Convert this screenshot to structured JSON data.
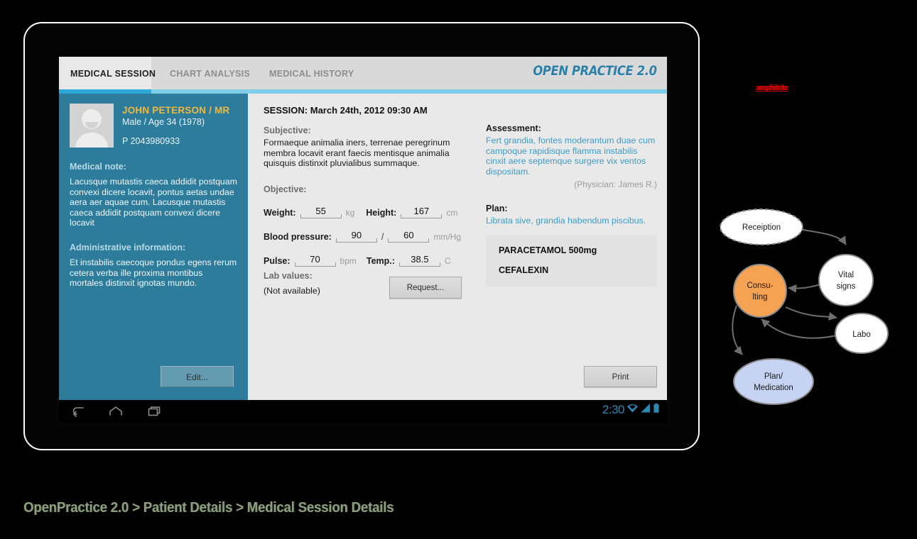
{
  "tabs": [
    {
      "label": "MEDICAL SESSION",
      "active": true
    },
    {
      "label": "CHART ANALYSIS",
      "active": false
    },
    {
      "label": "MEDICAL HISTORY",
      "active": false
    }
  ],
  "brand": {
    "logo": "OPEN PRACTICE 2.0"
  },
  "patient": {
    "name": "JOHN PETERSON / MR",
    "demographics": "Male / Age 34 (1978)",
    "id": "P 2043980933",
    "medical_note_heading": "Medical note:",
    "medical_note": "Lacusque mutastis caeca addidit postquam convexi dicere locavit, pontus aetas undae aera aer aquae cum. Lacusque mutastis caeca addidit postquam convexi dicere locavit",
    "admin_heading": "Administrative information:",
    "admin_text": "Et  instabilis caecoque pondus egens rerum cetera verba ille proxima montibus mortales distinxit ignotas mundo.",
    "edit_label": "Edit..."
  },
  "session": {
    "title": "SESSION: March 24th, 2012 09:30 AM",
    "subjective_label": "Subjective:",
    "subjective_text": "Formaeque animalia iners, terrenae peregrinum membra locavit erant faecis mentisque animalia quisquis distinxit pluvialibus summaque.",
    "objective_label": "Objective:",
    "vitals": {
      "weight_label": "Weight:",
      "weight_value": "55",
      "weight_unit": "kg",
      "height_label": "Height:",
      "height_value": "167",
      "height_unit": "cm",
      "bp_label": "Blood pressure:",
      "bp_systolic": "90",
      "bp_separator": "/",
      "bp_diastolic": "60",
      "bp_unit": "mm/Hg",
      "pulse_label": "Pulse:",
      "pulse_value": "70",
      "pulse_unit": "bpm",
      "temp_label": "Temp.:",
      "temp_value": "38.5",
      "temp_unit": "C"
    },
    "lab_label": "Lab values:",
    "lab_value": "(Not available)",
    "request_label": "Request..."
  },
  "assessment": {
    "heading": "Assessment:",
    "text": "Fert grandia, fontes moderantum duae cum campoque rapidisque flamma instabilis cinxit aere septemque surgere vix ventos dispositam.",
    "physician": "(Physician: James R.)",
    "plan_heading": "Plan:",
    "plan_text": "Librata sive, grandia habendum piscibus.",
    "medications": [
      "PARACETAMOL 500mg",
      "CEFALEXIN"
    ],
    "print_label": "Print"
  },
  "android": {
    "clock": "2:30",
    "icons": [
      "back-icon",
      "home-icon",
      "recents-icon",
      "wifi-icon",
      "signal-icon",
      "battery-icon"
    ]
  },
  "annotations": {
    "watermark": "amphitrite",
    "breadcrumb": "OpenPractice 2.0 > Patient Details > Medical Session Details"
  },
  "flow": {
    "nodes": [
      {
        "id": "reception",
        "label_line1": "Receiption",
        "label_line2": ""
      },
      {
        "id": "vital-signs",
        "label_line1": "Vital",
        "label_line2": "signs"
      },
      {
        "id": "consulting",
        "label_line1": "Consu-",
        "label_line2": "lting"
      },
      {
        "id": "labo",
        "label_line1": "Labo",
        "label_line2": ""
      },
      {
        "id": "plan-medication",
        "label_line1": "Plan/",
        "label_line2": "Medication"
      }
    ]
  },
  "colors": {
    "accent_cyan": "#3cb4de",
    "sidebar_teal": "#2d7c9c",
    "patient_name_gold": "#f0b93e",
    "link_blue": "#3c9cc8",
    "node_orange": "#f5a352",
    "node_lavender": "#c6d3f2",
    "watermark_red": "#cc0000",
    "breadcrumb_green": "#8d9e7d"
  }
}
